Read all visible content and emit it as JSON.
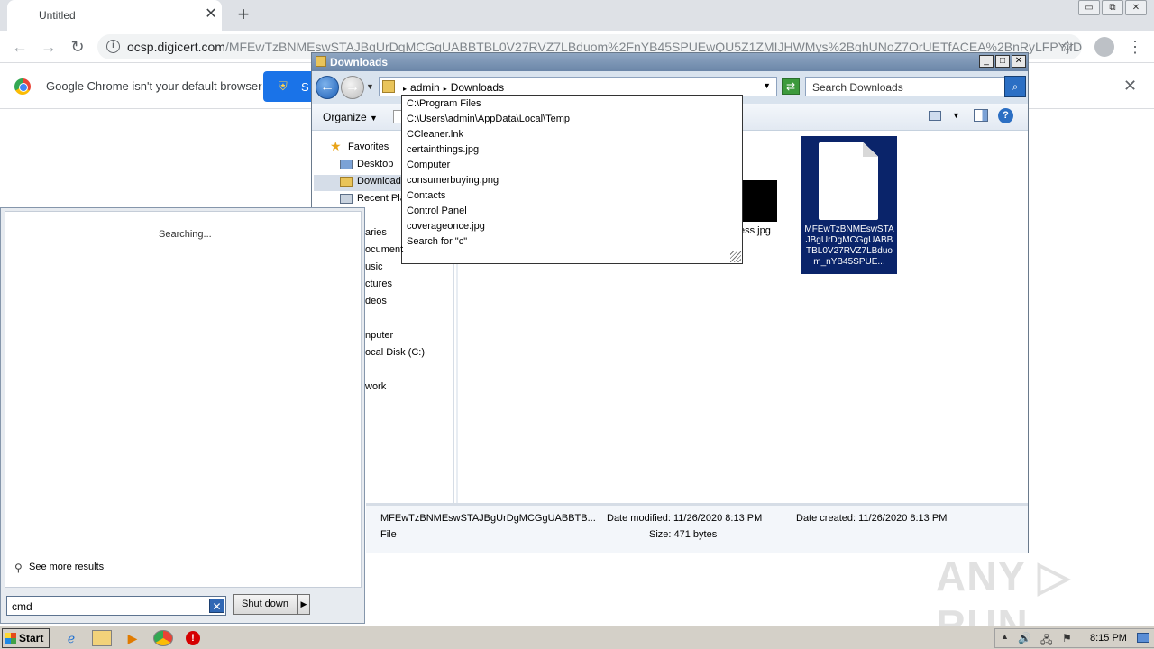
{
  "chrome": {
    "tab_title": "Untitled",
    "tab_close": "✕",
    "new_tab": "+",
    "window_controls": [
      "▭",
      "⧉",
      "✕"
    ],
    "back": "←",
    "forward": "→",
    "reload": "↻",
    "info_icon": "i",
    "url_host": "ocsp.digicert.com",
    "url_path": "/MFEwTzBNMEswSTAJBgUrDgMCGgUABBTBL0V27RVZ7LBduom%2FnYB45SPUEwQU5Z1ZMIJHWMys%2BghUNoZ7OrUETfACEA%2BnRyLFPYjID1i...",
    "star": "☆",
    "menu": "⋮",
    "infobar_text": "Google Chrome isn't your default browser",
    "infobar_button": "Set as default",
    "infobar_button_visible": "S",
    "infobar_close": "✕"
  },
  "explorer": {
    "title": "Downloads",
    "controls": [
      "_",
      "□",
      "✕"
    ],
    "breadcrumb": [
      "admin",
      "Downloads"
    ],
    "crumb_arrow": "▸",
    "search_placeholder": "Search Downloads",
    "organize_label": "Organize",
    "dropdown_arrow": "▼",
    "help": "?",
    "nav": {
      "favorites": "Favorites",
      "desktop": "Desktop",
      "downloads": "Downloads",
      "recent": "Recent Pla",
      "libraries": "aries",
      "documents": "ocument",
      "music": "usic",
      "pictures": "ctures",
      "videos": "deos",
      "computer": "nputer",
      "local_disk": "ocal Disk (C:)",
      "network": "work"
    },
    "files": {
      "partial_label": "ess.jpg",
      "selected_name": "MFEwTzBNMEswSTAJBgUrDgMCGgUABBTBL0V27RVZ7LBduom_nYB45SPUE..."
    },
    "details": {
      "name": "MFEwTzBNMEswSTAJBgUrDgMCGgUABBTB...",
      "type": "File",
      "date_modified": "Date modified: 11/26/2020 8:13 PM",
      "date_created": "Date created: 11/26/2020 8:13 PM",
      "size": "Size: 471 bytes"
    }
  },
  "address_dropdown": {
    "items": [
      "C:\\Program Files",
      "C:\\Users\\admin\\AppData\\Local\\Temp",
      "CCleaner.lnk",
      "certainthings.jpg",
      "Computer",
      "consumerbuying.png",
      "Contacts",
      "Control Panel",
      "coverageonce.jpg",
      "Search for \"c\""
    ]
  },
  "start_menu": {
    "status": "Searching...",
    "see_more": "See more results",
    "search_value": "cmd",
    "clear": "✕",
    "shutdown_label": "Shut down",
    "shutdown_arrow": "▶"
  },
  "watermark": "ANY ▷ RUN",
  "taskbar": {
    "start_label": "Start",
    "clock": "8:15 PM",
    "tray_icons": [
      "▲",
      "🔊",
      "🖧",
      "⚑"
    ]
  },
  "colors": {
    "chrome_blue": "#1a73e8",
    "selection": "#0a246a",
    "taskbar": "#d4d0c8"
  }
}
